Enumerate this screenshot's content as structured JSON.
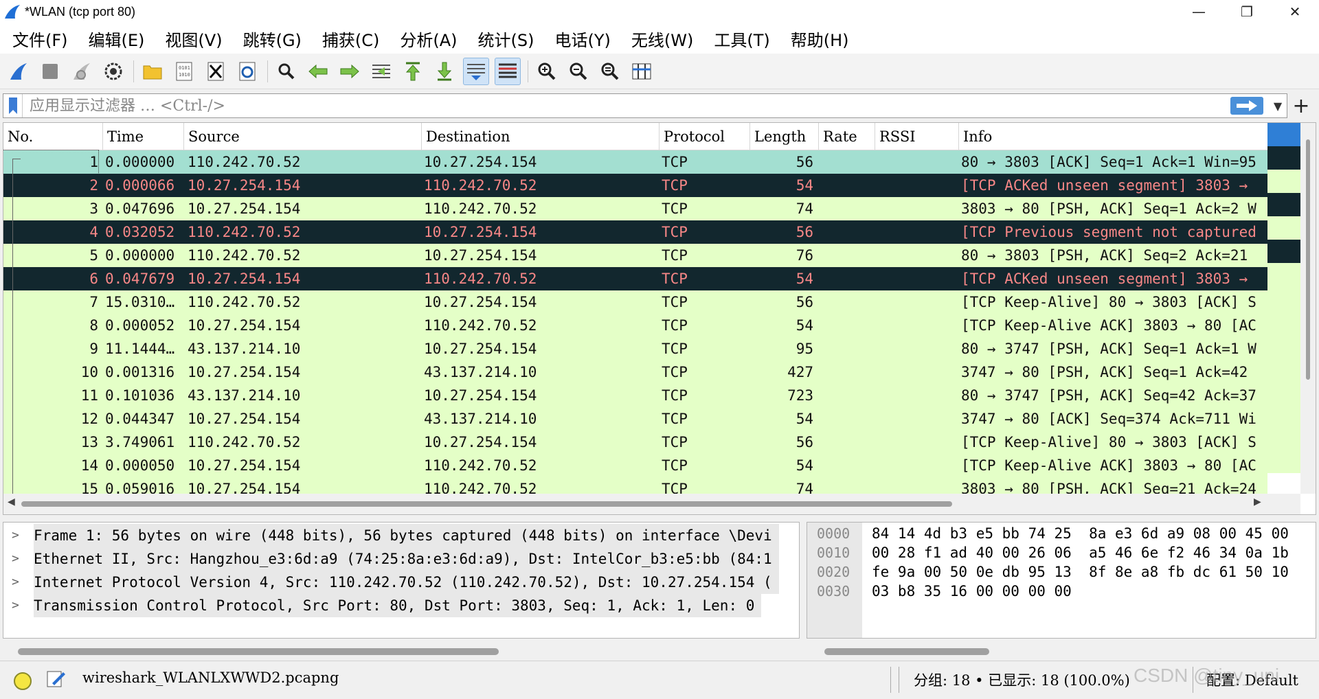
{
  "window": {
    "title": "*WLAN (tcp port 80)",
    "minimize": "—",
    "maximize": "❐",
    "close": "✕"
  },
  "menu": [
    "文件(F)",
    "编辑(E)",
    "视图(V)",
    "跳转(G)",
    "捕获(C)",
    "分析(A)",
    "统计(S)",
    "电话(Y)",
    "无线(W)",
    "工具(T)",
    "帮助(H)"
  ],
  "toolbar": {
    "icons": [
      "start-capture-icon",
      "stop-capture-icon",
      "restart-capture-icon",
      "capture-options-icon",
      "open-file-icon",
      "save-file-icon",
      "close-file-icon",
      "reload-file-icon",
      "find-packet-icon",
      "go-back-icon",
      "go-forward-icon",
      "go-to-packet-icon",
      "go-first-icon",
      "go-last-icon",
      "autoscroll-icon",
      "colorize-icon",
      "zoom-in-icon",
      "zoom-out-icon",
      "zoom-normal-icon",
      "resize-columns-icon"
    ]
  },
  "filter": {
    "placeholder": "应用显示过滤器 … <Ctrl-/>"
  },
  "packet_list": {
    "columns": [
      "No.",
      "Time",
      "Source",
      "Destination",
      "Protocol",
      "Length",
      "Rate",
      "RSSI",
      "Info"
    ],
    "rows": [
      {
        "no": "1",
        "time": "0.000000",
        "src": "110.242.70.52",
        "dst": "10.27.254.154",
        "proto": "TCP",
        "len": "56",
        "info": "80 → 3803 [ACK] Seq=1 Ack=1 Win=95",
        "style": "selected"
      },
      {
        "no": "2",
        "time": "0.000066",
        "src": "10.27.254.154",
        "dst": "110.242.70.52",
        "proto": "TCP",
        "len": "54",
        "info": "[TCP ACKed unseen segment] 3803 →",
        "style": "dark"
      },
      {
        "no": "3",
        "time": "0.047696",
        "src": "10.27.254.154",
        "dst": "110.242.70.52",
        "proto": "TCP",
        "len": "74",
        "info": "3803 → 80 [PSH, ACK] Seq=1 Ack=2 W",
        "style": "green"
      },
      {
        "no": "4",
        "time": "0.032052",
        "src": "110.242.70.52",
        "dst": "10.27.254.154",
        "proto": "TCP",
        "len": "56",
        "info": "[TCP Previous segment not captured",
        "style": "dark"
      },
      {
        "no": "5",
        "time": "0.000000",
        "src": "110.242.70.52",
        "dst": "10.27.254.154",
        "proto": "TCP",
        "len": "76",
        "info": "80 → 3803 [PSH, ACK] Seq=2 Ack=21",
        "style": "green"
      },
      {
        "no": "6",
        "time": "0.047679",
        "src": "10.27.254.154",
        "dst": "110.242.70.52",
        "proto": "TCP",
        "len": "54",
        "info": "[TCP ACKed unseen segment] 3803 →",
        "style": "dark"
      },
      {
        "no": "7",
        "time": "15.0310…",
        "src": "110.242.70.52",
        "dst": "10.27.254.154",
        "proto": "TCP",
        "len": "56",
        "info": "[TCP Keep-Alive] 80 → 3803 [ACK] S",
        "style": "green"
      },
      {
        "no": "8",
        "time": "0.000052",
        "src": "10.27.254.154",
        "dst": "110.242.70.52",
        "proto": "TCP",
        "len": "54",
        "info": "[TCP Keep-Alive ACK] 3803 → 80 [AC",
        "style": "green"
      },
      {
        "no": "9",
        "time": "11.1444…",
        "src": "43.137.214.10",
        "dst": "10.27.254.154",
        "proto": "TCP",
        "len": "95",
        "info": "80 → 3747 [PSH, ACK] Seq=1 Ack=1 W",
        "style": "green"
      },
      {
        "no": "10",
        "time": "0.001316",
        "src": "10.27.254.154",
        "dst": "43.137.214.10",
        "proto": "TCP",
        "len": "427",
        "info": "3747 → 80 [PSH, ACK] Seq=1 Ack=42",
        "style": "green"
      },
      {
        "no": "11",
        "time": "0.101036",
        "src": "43.137.214.10",
        "dst": "10.27.254.154",
        "proto": "TCP",
        "len": "723",
        "info": "80 → 3747 [PSH, ACK] Seq=42 Ack=37",
        "style": "green"
      },
      {
        "no": "12",
        "time": "0.044347",
        "src": "10.27.254.154",
        "dst": "43.137.214.10",
        "proto": "TCP",
        "len": "54",
        "info": "3747 → 80 [ACK] Seq=374 Ack=711 Wi",
        "style": "green"
      },
      {
        "no": "13",
        "time": "3.749061",
        "src": "110.242.70.52",
        "dst": "10.27.254.154",
        "proto": "TCP",
        "len": "56",
        "info": "[TCP Keep-Alive] 80 → 3803 [ACK] S",
        "style": "green"
      },
      {
        "no": "14",
        "time": "0.000050",
        "src": "10.27.254.154",
        "dst": "110.242.70.52",
        "proto": "TCP",
        "len": "54",
        "info": "[TCP Keep-Alive ACK] 3803 → 80 [AC",
        "style": "green"
      },
      {
        "no": "15",
        "time": "0.059016",
        "src": "10.27.254.154",
        "dst": "110.242.70.52",
        "proto": "TCP",
        "len": "74",
        "info": "3803 → 80 [PSH, ACK] Seq=21 Ack=24",
        "style": "green"
      }
    ]
  },
  "details": [
    "Frame 1: 56 bytes on wire (448 bits), 56 bytes captured (448 bits) on interface \\Devi",
    "Ethernet II, Src: Hangzhou_e3:6d:a9 (74:25:8a:e3:6d:a9), Dst: IntelCor_b3:e5:bb (84:1",
    "Internet Protocol Version 4, Src: 110.242.70.52 (110.242.70.52), Dst: 10.27.254.154 (",
    "Transmission Control Protocol, Src Port: 80, Dst Port: 3803, Seq: 1, Ack: 1, Len: 0"
  ],
  "hex": {
    "offsets": [
      "0000",
      "0010",
      "0020",
      "0030"
    ],
    "lines": [
      "84 14 4d b3 e5 bb 74 25  8a e3 6d a9 08 00 45 00",
      "00 28 f1 ad 40 00 26 06  a5 46 6e f2 46 34 0a 1b",
      "fe 9a 00 50 0e db 95 13  8f 8e a8 fb dc 61 50 10",
      "03 b8 35 16 00 00 00 00"
    ]
  },
  "status": {
    "file": "wireshark_WLANLXWWD2.pcapng",
    "stats": "分组: 18 • 已显示: 18 (100.0%)",
    "profile": "配置: Default",
    "watermark": "CSDN @tiny_uni"
  },
  "colors": {
    "row_green": "#e4ffc7",
    "row_dark": "#12272e",
    "row_dark_text": "#f78787",
    "row_selected": "#a3dfd1",
    "accent": "#4a90d9"
  }
}
